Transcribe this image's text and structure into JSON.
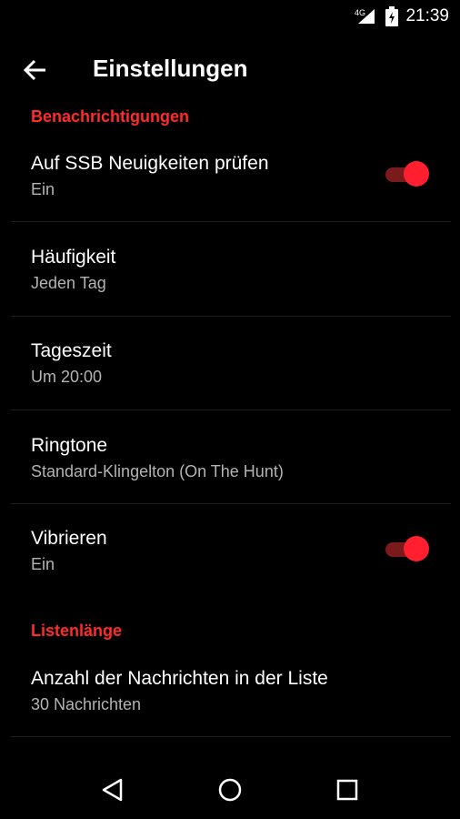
{
  "status": {
    "time": "21:39"
  },
  "appbar": {
    "title": "Einstellungen"
  },
  "sections": {
    "notifications": "Benachrichtigungen",
    "list_length": "Listenlänge"
  },
  "items": [
    {
      "label": "Auf SSB Neuigkeiten prüfen",
      "value": "Ein",
      "toggle": true
    },
    {
      "label": "Häufigkeit",
      "value": "Jeden Tag"
    },
    {
      "label": "Tageszeit",
      "value": "Um 20:00"
    },
    {
      "label": "Ringtone",
      "value": "Standard-Klingelton (On The Hunt)"
    },
    {
      "label": "Vibrieren",
      "value": "Ein",
      "toggle": true
    },
    {
      "label": "Anzahl der Nachrichten in der Liste",
      "value": "30 Nachrichten"
    }
  ],
  "colors": {
    "accent": "#ff2b2b",
    "background": "#000000",
    "secondary_text": "#b3b3b3"
  },
  "icons": {
    "status": [
      "no-sim-icon",
      "signal-icon",
      "battery-icon"
    ],
    "back": "arrow-back-icon",
    "nav": [
      "back-triangle-icon",
      "home-circle-icon",
      "recents-square-icon"
    ]
  }
}
